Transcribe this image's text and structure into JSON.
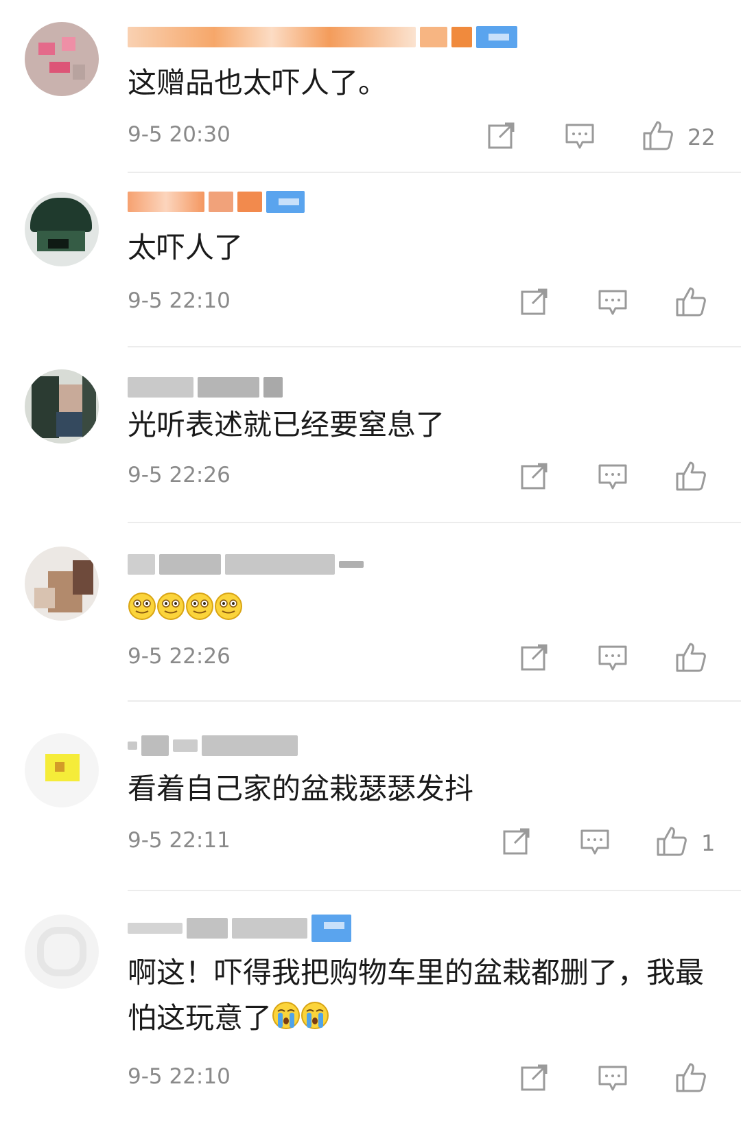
{
  "comments": [
    {
      "text": "这赠品也太吓人了。",
      "time": "9-5 20:30",
      "likes": "22",
      "emoji_count": 0
    },
    {
      "text": "太吓人了",
      "time": "9-5 22:10",
      "likes": "",
      "emoji_count": 0
    },
    {
      "text": "光听表述就已经要窒息了",
      "time": "9-5 22:26",
      "likes": "",
      "emoji_count": 0
    },
    {
      "text": "",
      "time": "9-5 22:26",
      "likes": "",
      "emoji_count": 4,
      "emoji": "smirk-face"
    },
    {
      "text": "看着自己家的盆栽瑟瑟发抖",
      "time": "9-5 22:11",
      "likes": "1",
      "emoji_count": 0
    },
    {
      "text": "啊这！吓得我把购物车里的盆栽都删了，我最怕这玩意了",
      "time": "9-5 22:10",
      "likes": "",
      "emoji_count": 2,
      "emoji": "crying-face"
    }
  ],
  "icons": {
    "share": "share-icon",
    "reply": "comment-icon",
    "like": "thumbs-up-icon"
  },
  "colors": {
    "text": "#1a1a1a",
    "meta": "#8a8a8a",
    "icon": "#9a9a9a",
    "divider": "#ececec",
    "badge": "#5aa4ee"
  }
}
